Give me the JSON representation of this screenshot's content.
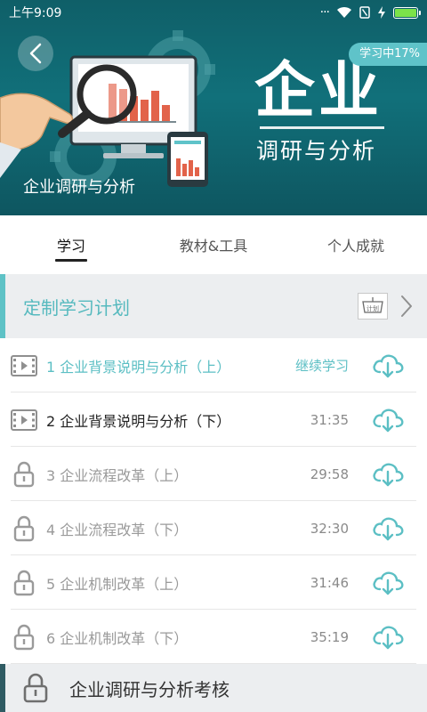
{
  "status_bar": {
    "time": "上午9:09"
  },
  "hero": {
    "big_title": "企业",
    "subtitle": "调研与分析",
    "caption": "企业调研与分析",
    "progress_badge": "学习中17%"
  },
  "tabs": [
    {
      "label": "学习",
      "active": true
    },
    {
      "label": "教材&工具",
      "active": false
    },
    {
      "label": "个人成就",
      "active": false
    }
  ],
  "plan": {
    "label": "定制学习计划",
    "icon_text": "计划"
  },
  "lessons": [
    {
      "title": "1 企业背景说明与分析（上）",
      "meta": "继续学习",
      "state": "current"
    },
    {
      "title": "2 企业背景说明与分析（下）",
      "meta": "31:35",
      "state": "unlocked"
    },
    {
      "title": "3 企业流程改革（上）",
      "meta": "29:58",
      "state": "locked"
    },
    {
      "title": "4 企业流程改革（下）",
      "meta": "32:30",
      "state": "locked"
    },
    {
      "title": "5 企业机制改革（上）",
      "meta": "31:46",
      "state": "locked"
    },
    {
      "title": "6 企业机制改革（下）",
      "meta": "35:19",
      "state": "locked"
    }
  ],
  "exam": {
    "label": "企业调研与分析考核"
  },
  "icons": {
    "back": "chevron-left-icon",
    "video": "video-icon",
    "lock": "lock-icon",
    "download": "cloud-download-icon",
    "chevron": "chevron-right-icon"
  },
  "colors": {
    "accent": "#5ec2c6",
    "hero_bg": "#11707a",
    "locked_text": "#9a9a9a"
  }
}
